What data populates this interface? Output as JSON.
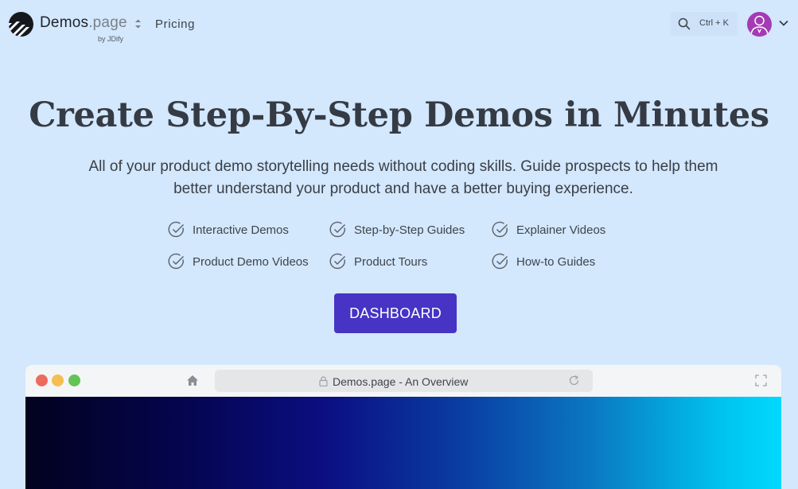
{
  "header": {
    "brand_name": "Demos",
    "brand_suffix": ".page",
    "byline": "by JDify",
    "nav": {
      "pricing_label": "Pricing"
    },
    "search": {
      "shortcut": "Ctrl + K"
    }
  },
  "hero": {
    "title": "Create Step-By-Step Demos in Minutes",
    "subtitle": "All of your product demo storytelling needs without coding skills. Guide prospects to help them better understand your product and have a better buying experience.",
    "features": [
      "Interactive Demos",
      "Step-by-Step Guides",
      "Explainer Videos",
      "Product Demo Videos",
      "Product Tours",
      "How-to Guides"
    ],
    "cta_label": "DASHBOARD"
  },
  "browser_mock": {
    "address_text": "Demos.page - An Overview"
  },
  "colors": {
    "background": "#d3e7fd",
    "cta": "#4733c4",
    "avatar": "#a43bb5",
    "close_dot": "#ee6a5f",
    "minimize_dot": "#f5be4f",
    "maximize_dot": "#62c454"
  },
  "icons": [
    "logo-icon",
    "sort-icon",
    "search-icon",
    "user-icon",
    "chevron-down-icon",
    "check-circle-icon",
    "home-icon",
    "lock-icon",
    "reload-icon",
    "fullscreen-icon"
  ]
}
